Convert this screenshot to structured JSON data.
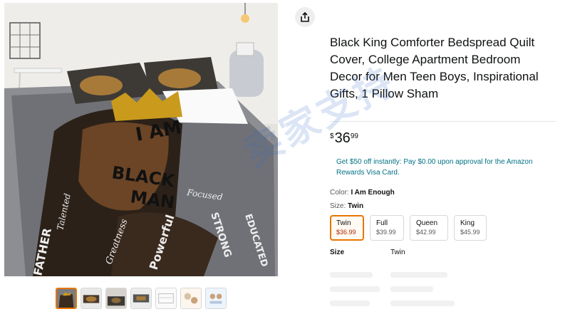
{
  "product": {
    "title": "Black King Comforter Bedspread Quilt Cover, College Apartment Bedroom Decor for Men Teen Boys, Inspirational Gifts, 1 Pillow Sham",
    "price": {
      "symbol": "$",
      "whole": "36",
      "fraction": "99"
    },
    "promo_text": "Get $50 off instantly: Pay $0.00 upon approval for the Amazon Rewards Visa Card.",
    "color_label": "Color:",
    "color_value": "I Am Enough",
    "size_label": "Size:",
    "size_value": "Twin",
    "size_options": [
      {
        "name": "Twin",
        "price": "$36.99",
        "selected": true
      },
      {
        "name": "Full",
        "price": "$39.99",
        "selected": false
      },
      {
        "name": "Queen",
        "price": "$42.99",
        "selected": false
      },
      {
        "name": "King",
        "price": "$45.99",
        "selected": false
      }
    ],
    "spec": {
      "label": "Size",
      "value": "Twin"
    }
  },
  "image_text": {
    "line1": "I AM",
    "line2": "BLACK",
    "line3": "MAN",
    "words": [
      "Focused",
      "Greatness",
      "Powerful",
      "FATHER",
      "Talented",
      "STRONG",
      "EDUCATED"
    ]
  },
  "watermark": "卖家支持",
  "icons": {
    "share": "share-icon"
  },
  "colors": {
    "accent_orange": "#e77600",
    "link_teal": "#007185",
    "price_red": "#b12704",
    "crown_gold": "#c99a1c"
  }
}
